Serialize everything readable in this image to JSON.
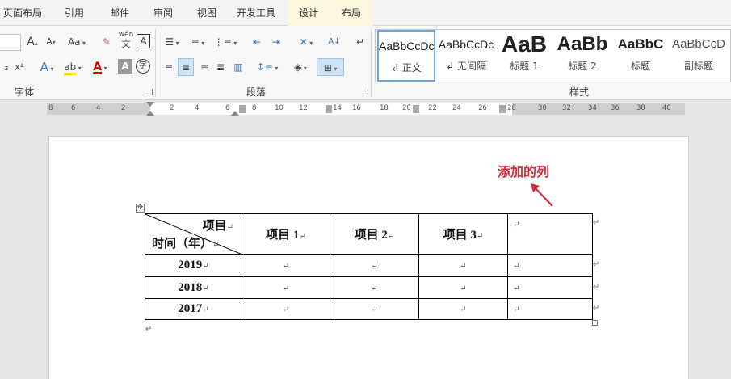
{
  "tabs": [
    {
      "label": "页面布局"
    },
    {
      "label": "引用"
    },
    {
      "label": "邮件"
    },
    {
      "label": "审阅"
    },
    {
      "label": "视图"
    },
    {
      "label": "开发工具"
    },
    {
      "label": "设计"
    },
    {
      "label": "布局"
    }
  ],
  "ribbon": {
    "font_group_label": "字体",
    "paragraph_group_label": "段落",
    "styles_group_label": "样式",
    "font_btns": {
      "grow": "A",
      "shrink": "A",
      "change_case": "Aa",
      "phonetic_top": "wén",
      "phonetic_bottom": "文",
      "char_border": "A",
      "superscript": "x²",
      "text_effect": "A",
      "highlight": "ab",
      "font_color": "A",
      "char_shading": "A",
      "enclose": "字"
    },
    "styles": [
      {
        "sample": "AaBbCcDc",
        "name": "↲ 正文",
        "selected": true
      },
      {
        "sample": "AaBbCcDc",
        "name": "↲ 无间隔",
        "selected": false
      },
      {
        "sample": "AaB",
        "name": "标题 1",
        "selected": false
      },
      {
        "sample": "AaBb",
        "name": "标题 2",
        "selected": false
      },
      {
        "sample": "AaBbC",
        "name": "标题",
        "selected": false
      },
      {
        "sample": "AaBbCcD",
        "name": "副标题",
        "selected": false
      }
    ]
  },
  "ruler": {
    "labels": [
      "8",
      "6",
      "4",
      "2",
      "2",
      "4",
      "6",
      "8",
      "10",
      "12",
      "14",
      "16",
      "18",
      "20",
      "22",
      "24",
      "26",
      "28",
      "30",
      "32",
      "34",
      "36",
      "38",
      "40"
    ]
  },
  "annotation": {
    "text": "添加的列",
    "color": "#d62b36"
  },
  "table": {
    "diag_top": "项目",
    "diag_bottom": "时间（年）",
    "headers": [
      "项目 1",
      "项目 2",
      "项目 3",
      ""
    ],
    "rows": [
      {
        "year": "2019"
      },
      {
        "year": "2018"
      },
      {
        "year": "2017"
      }
    ]
  },
  "marks": {
    "cell": "↵"
  }
}
